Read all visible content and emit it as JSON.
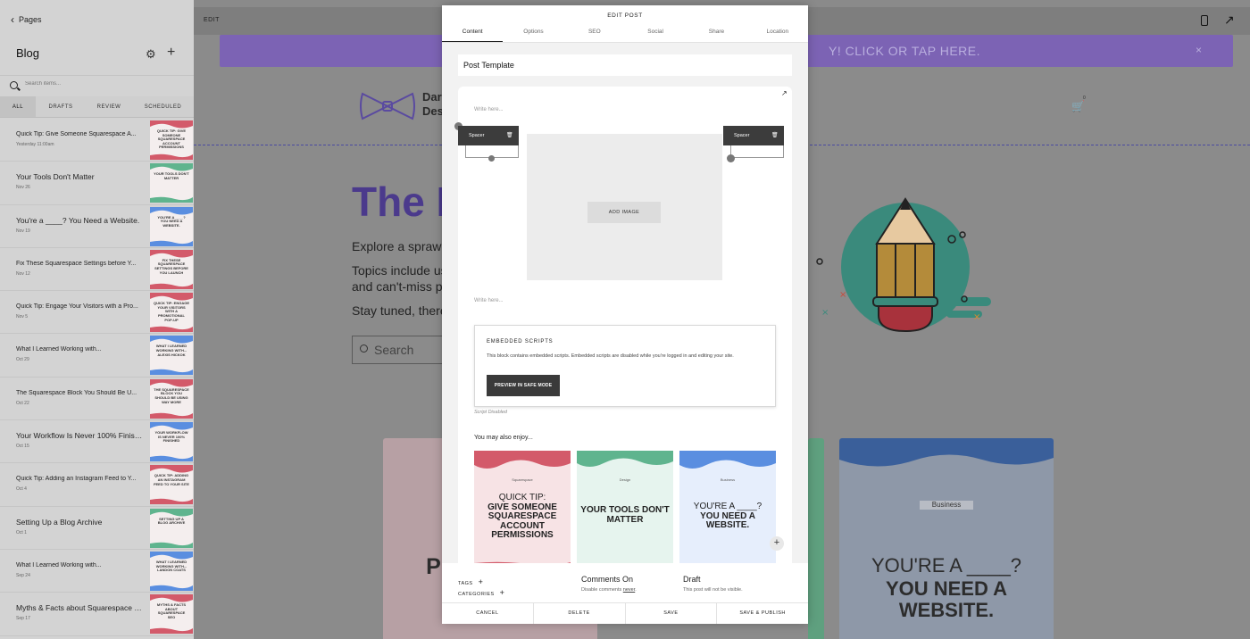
{
  "sidebar": {
    "back_label": "Pages",
    "title": "Blog",
    "search_placeholder": "Search items...",
    "tabs": [
      "ALL",
      "DRAFTS",
      "REVIEW",
      "SCHEDULED"
    ],
    "posts": [
      {
        "title": "Quick Tip: Give Someone Squarespace A...",
        "date": "Yesterday 11:00am",
        "thumb": "QUICK TIP: GIVE SOMEONE SQUARESPACE ACCOUNT PERMISSIONS",
        "color": "#d35a6a"
      },
      {
        "title": "Your Tools Don't Matter",
        "date": "Nov 26",
        "thumb": "YOUR TOOLS DON'T MATTER",
        "color": "#5fb48e"
      },
      {
        "title": "You're a ____? You Need a Website.",
        "date": "Nov 19",
        "thumb": "YOU'RE A ____? YOU NEED A WEBSITE.",
        "color": "#5a8ee0"
      },
      {
        "title": "Fix These Squarespace Settings before Y...",
        "date": "Nov 12",
        "thumb": "FIX THESE SQUARESPACE SETTINGS BEFORE YOU LAUNCH",
        "color": "#d35a6a"
      },
      {
        "title": "Quick Tip: Engage Your Visitors with a Pro...",
        "date": "Nov 5",
        "thumb": "QUICK TIP: ENGAGE YOUR VISITORS WITH A PROMOTIONAL POP-UP",
        "color": "#d35a6a"
      },
      {
        "title": "What I Learned Working with...",
        "date": "Oct 29",
        "thumb": "WHAT I LEARNED WORKING WITH... ALEXIS HICKOK",
        "color": "#5a8ee0"
      },
      {
        "title": "The Squarespace Block You Should Be U...",
        "date": "Oct 22",
        "thumb": "THE SQUARESPACE BLOCK YOU SHOULD BE USING WAY MORE",
        "color": "#d35a6a"
      },
      {
        "title": "Your Workflow Is Never 100% Finished",
        "date": "Oct 15",
        "thumb": "YOUR WORKFLOW IS NEVER 100% FINISHED",
        "color": "#5a8ee0"
      },
      {
        "title": "Quick Tip: Adding an Instagram Feed to Y...",
        "date": "Oct 4",
        "thumb": "QUICK TIP: ADDING AN INSTAGRAM FEED TO YOUR SITE",
        "color": "#d35a6a"
      },
      {
        "title": "Setting Up a Blog Archive",
        "date": "Oct 1",
        "thumb": "SETTING UP A BLOG ARCHIVE",
        "color": "#5fb48e"
      },
      {
        "title": "What I Learned Working with...",
        "date": "Sep 24",
        "thumb": "WHAT I LEARNED WORKING WITH... LANDON COATS",
        "color": "#5a8ee0"
      },
      {
        "title": "Myths & Facts about Squarespace SEO",
        "date": "Sep 17",
        "thumb": "MYTHS & FACTS ABOUT SQUARESPACE SEO",
        "color": "#d35a6a"
      }
    ]
  },
  "editor": {
    "mode_label": "EDIT",
    "banner_text": "Y! CLICK OR TAP HERE.",
    "banner_close": "×",
    "logo_text_line1": "Dar",
    "logo_text_line2": "Des",
    "cart_count": "0",
    "hero_title": "The D",
    "hero_p1": "Explore a sprawli",
    "hero_p2": "Topics include us",
    "hero_p3": "and can't-miss pr",
    "hero_p4": "Stay tuned, there",
    "search_label": "Search",
    "card1_text": "G GIV SQ PERMISSIONS",
    "card3_category": "Business",
    "card3_line1": "YOU'RE A ____?",
    "card3_line2": "YOU NEED A WEBSITE."
  },
  "modal": {
    "title": "EDIT POST",
    "tabs": [
      "Content",
      "Options",
      "SEO",
      "Social",
      "Share",
      "Location"
    ],
    "post_title_value": "Post Template",
    "write_here": "Write here...",
    "spacer_label": "Spacer",
    "add_image_label": "ADD IMAGE",
    "embed_heading": "EMBEDDED SCRIPTS",
    "embed_text": "This block contains embedded scripts. Embedded scripts are disabled while you're logged in and editing your site.",
    "embed_button": "PREVIEW IN SAFE MODE",
    "script_disabled": "Script Disabled",
    "also_enjoy": "You may also enjoy...",
    "related": [
      {
        "category": "Squarespace",
        "text_thin": "QUICK TIP:",
        "text_bold": "GIVE SOMEONE SQUARESPACE ACCOUNT PERMISSIONS"
      },
      {
        "category": "Design",
        "text_thin": "",
        "text_bold": "YOUR TOOLS DON'T MATTER"
      },
      {
        "category": "Business",
        "text_thin": "YOU'RE A ____?",
        "text_bold": "YOU NEED A WEBSITE."
      }
    ],
    "tags_label": "TAGS",
    "categories_label": "CATEGORIES",
    "comments_heading": "Comments On",
    "comments_sub_prefix": "Disable comments",
    "comments_sub_link": "never",
    "draft_heading": "Draft",
    "draft_sub": "This post will not be visible.",
    "actions": [
      "CANCEL",
      "DELETE",
      "SAVE",
      "SAVE & PUBLISH"
    ]
  },
  "colors": {
    "banner": "#7c63b4",
    "hero_title": "#4b3a8c",
    "red_wave": "#d35a6a",
    "green_wave": "#5fb48e",
    "blue_wave": "#5a8ee0"
  }
}
